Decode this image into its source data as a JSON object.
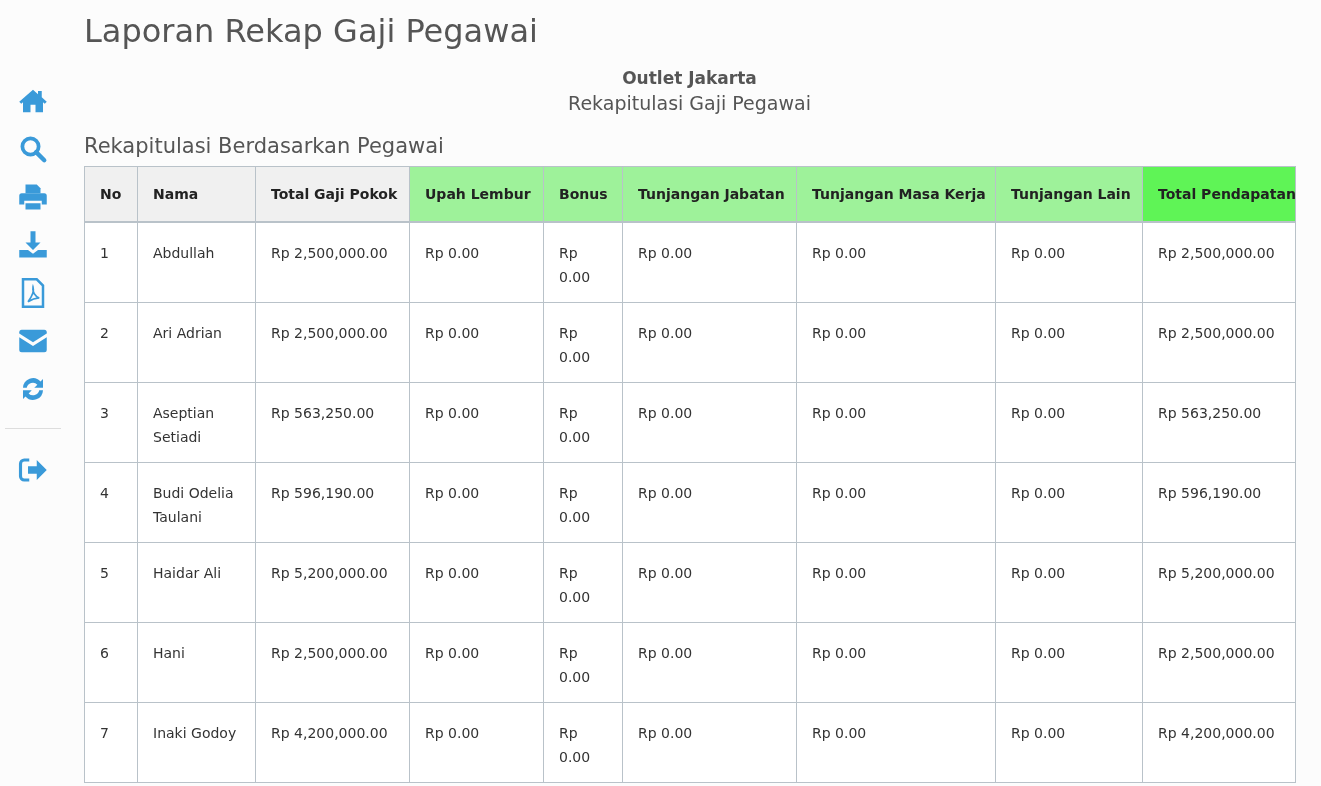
{
  "title": "Laporan Rekap Gaji Pegawai",
  "outlet": "Outlet Jakarta",
  "subtitle": "Rekapitulasi Gaji Pegawai",
  "section_title": "Rekapitulasi Berdasarkan Pegawai",
  "table": {
    "columns": [
      {
        "label": "No",
        "color": "#f0f0f0"
      },
      {
        "label": "Nama",
        "color": "#f0f0f0"
      },
      {
        "label": "Total Gaji Pokok",
        "color": "#f0f0f0"
      },
      {
        "label": "Upah Lembur",
        "color": "#9ef29a"
      },
      {
        "label": "Bonus",
        "color": "#9ef29a"
      },
      {
        "label": "Tunjangan Jabatan",
        "color": "#9ef29a"
      },
      {
        "label": "Tunjangan Masa Kerja",
        "color": "#9ef29a"
      },
      {
        "label": "Tunjangan Lain",
        "color": "#9ef29a"
      },
      {
        "label": "Total Pendapatan",
        "color": "#5ff456"
      }
    ],
    "rows": [
      [
        "1",
        "Abdullah",
        "Rp 2,500,000.00",
        "Rp 0.00",
        "Rp 0.00",
        "Rp 0.00",
        "Rp 0.00",
        "Rp 0.00",
        "Rp 2,500,000.00"
      ],
      [
        "2",
        "Ari Adrian",
        "Rp 2,500,000.00",
        "Rp 0.00",
        "Rp 0.00",
        "Rp 0.00",
        "Rp 0.00",
        "Rp 0.00",
        "Rp 2,500,000.00"
      ],
      [
        "3",
        "Aseptian Setiadi",
        "Rp 563,250.00",
        "Rp 0.00",
        "Rp 0.00",
        "Rp 0.00",
        "Rp 0.00",
        "Rp 0.00",
        "Rp 563,250.00"
      ],
      [
        "4",
        "Budi Odelia Taulani",
        "Rp 596,190.00",
        "Rp 0.00",
        "Rp 0.00",
        "Rp 0.00",
        "Rp 0.00",
        "Rp 0.00",
        "Rp 596,190.00"
      ],
      [
        "5",
        "Haidar Ali",
        "Rp 5,200,000.00",
        "Rp 0.00",
        "Rp 0.00",
        "Rp 0.00",
        "Rp 0.00",
        "Rp 0.00",
        "Rp 5,200,000.00"
      ],
      [
        "6",
        "Hani",
        "Rp 2,500,000.00",
        "Rp 0.00",
        "Rp 0.00",
        "Rp 0.00",
        "Rp 0.00",
        "Rp 0.00",
        "Rp 2,500,000.00"
      ],
      [
        "7",
        "Inaki Godoy",
        "Rp 4,200,000.00",
        "Rp 0.00",
        "Rp 0.00",
        "Rp 0.00",
        "Rp 0.00",
        "Rp 0.00",
        "Rp 4,200,000.00"
      ]
    ]
  }
}
